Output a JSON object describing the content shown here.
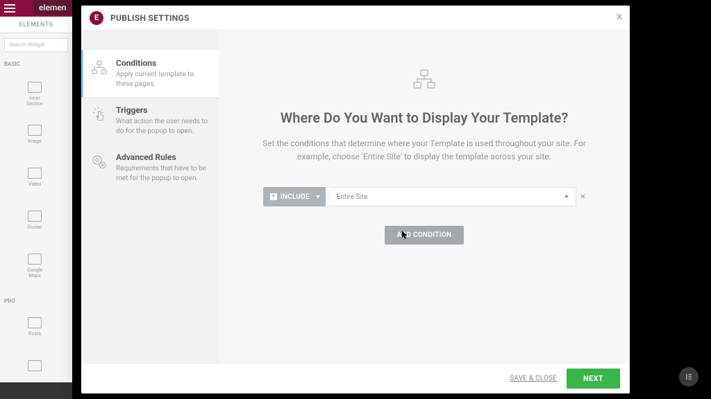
{
  "background": {
    "brand": "elemen",
    "elements_header": "ELEMENTS",
    "search_placeholder": "Search Widget",
    "section_basic": "BASIC",
    "section_pro": "PRO",
    "widgets": {
      "inner_section": "Inner Section",
      "image": "Image",
      "video": "Video",
      "divider": "Divider",
      "google_maps": "Google Maps",
      "posts": "Posts"
    }
  },
  "modal": {
    "title": "PUBLISH SETTINGS",
    "nav": [
      {
        "title": "Conditions",
        "desc": "Apply current template to these pages."
      },
      {
        "title": "Triggers",
        "desc": "What action the user needs to do for the popup to open."
      },
      {
        "title": "Advanced Rules",
        "desc": "Requirements that have to be met for the popup to open."
      }
    ],
    "main": {
      "title": "Where Do You Want to Display Your Template?",
      "desc": "Set the conditions that determine where your Template is used throughout your site. For example, choose 'Entire Site' to display the template across your site.",
      "include_label": "INCLUDE",
      "condition_value": "Entire Site",
      "add_condition": "ADD CONDITION"
    },
    "footer": {
      "save_close": "SAVE & CLOSE",
      "next": "NEXT"
    }
  }
}
